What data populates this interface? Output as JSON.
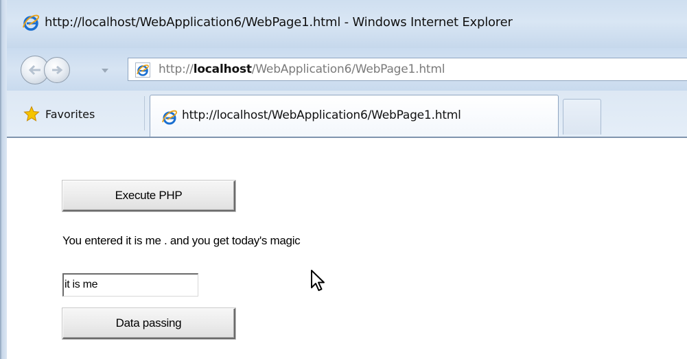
{
  "window": {
    "title": "http://localhost/WebApplication6/WebPage1.html - Windows Internet Explorer"
  },
  "address_bar": {
    "prefix": "http://",
    "host": "localhost",
    "path": "/WebApplication6/WebPage1.html"
  },
  "favorites": {
    "label": "Favorites"
  },
  "tabs": [
    {
      "label": "http://localhost/WebApplication6/WebPage1.html",
      "active": true
    }
  ],
  "page": {
    "execute_button_label": "Execute PHP",
    "result_text": "You entered it is me . and you get today's magic",
    "input_value": "it is me",
    "data_button_label": "Data passing"
  },
  "icons": {
    "browser": "ie-icon",
    "favorites": "star-icon",
    "back": "back-arrow-icon",
    "forward": "forward-arrow-icon",
    "cursor": "mouse-pointer-icon"
  },
  "colors": {
    "chrome_blue": "#d7e4f3",
    "ie_blue": "#1a6fd0"
  }
}
